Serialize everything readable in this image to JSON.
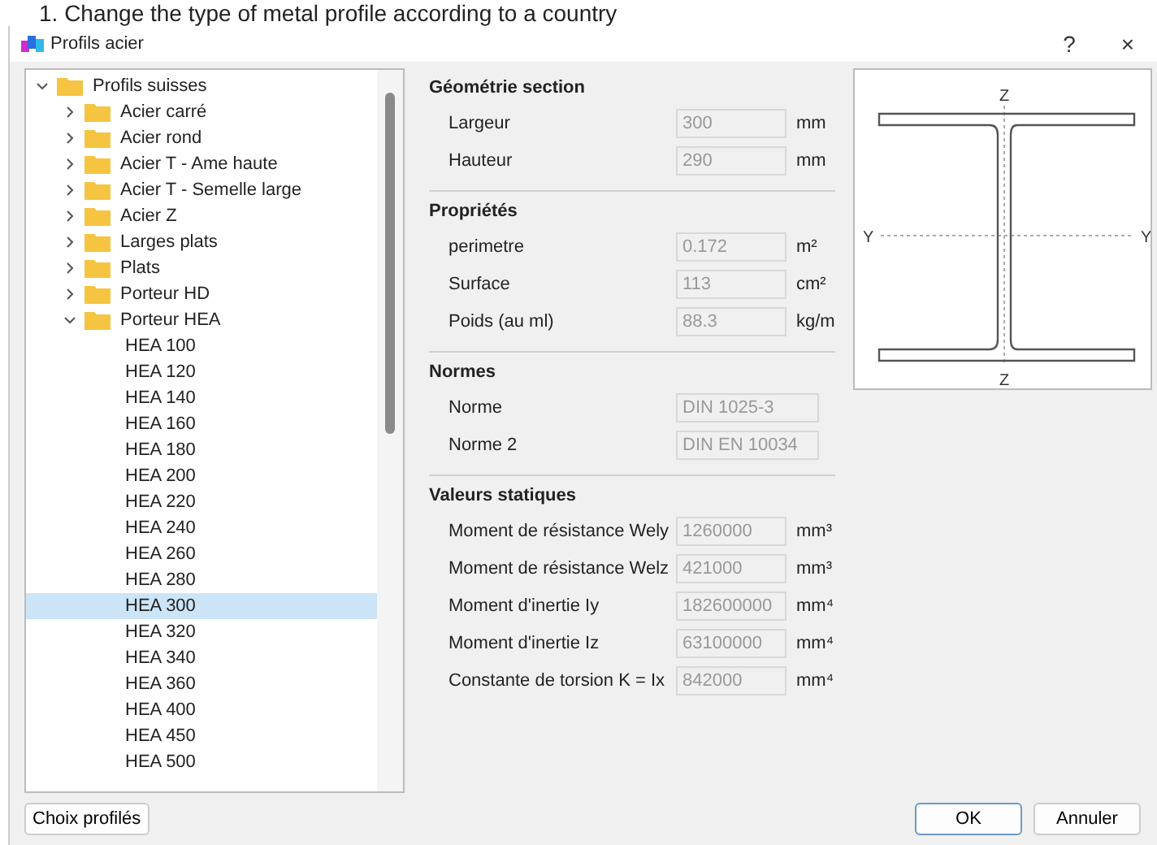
{
  "caption": "1. Change the type of metal profile according to a country",
  "window": {
    "title": "Profils acier",
    "help": "?",
    "close": "×"
  },
  "tree": [
    {
      "label": "Profils suisses",
      "kind": "folder",
      "expanded": true,
      "selected": false,
      "children": [
        {
          "label": "Acier carré",
          "kind": "folder",
          "expanded": false,
          "selected": false
        },
        {
          "label": "Acier rond",
          "kind": "folder",
          "expanded": false,
          "selected": false
        },
        {
          "label": "Acier T - Ame haute",
          "kind": "folder",
          "expanded": false,
          "selected": false
        },
        {
          "label": "Acier T - Semelle large",
          "kind": "folder",
          "expanded": false,
          "selected": false
        },
        {
          "label": "Acier Z",
          "kind": "folder",
          "expanded": false,
          "selected": false
        },
        {
          "label": "Larges plats",
          "kind": "folder",
          "expanded": false,
          "selected": false
        },
        {
          "label": "Plats",
          "kind": "folder",
          "expanded": false,
          "selected": false
        },
        {
          "label": "Porteur HD",
          "kind": "folder",
          "expanded": false,
          "selected": false
        },
        {
          "label": "Porteur HEA",
          "kind": "folder",
          "expanded": true,
          "selected": false,
          "children": [
            {
              "label": "HEA 100",
              "kind": "item",
              "selected": false
            },
            {
              "label": "HEA 120",
              "kind": "item",
              "selected": false
            },
            {
              "label": "HEA 140",
              "kind": "item",
              "selected": false
            },
            {
              "label": "HEA 160",
              "kind": "item",
              "selected": false
            },
            {
              "label": "HEA 180",
              "kind": "item",
              "selected": false
            },
            {
              "label": "HEA 200",
              "kind": "item",
              "selected": false
            },
            {
              "label": "HEA 220",
              "kind": "item",
              "selected": false
            },
            {
              "label": "HEA 240",
              "kind": "item",
              "selected": false
            },
            {
              "label": "HEA 260",
              "kind": "item",
              "selected": false
            },
            {
              "label": "HEA 280",
              "kind": "item",
              "selected": false
            },
            {
              "label": "HEA 300",
              "kind": "item",
              "selected": true
            },
            {
              "label": "HEA 320",
              "kind": "item",
              "selected": false
            },
            {
              "label": "HEA 340",
              "kind": "item",
              "selected": false
            },
            {
              "label": "HEA 360",
              "kind": "item",
              "selected": false
            },
            {
              "label": "HEA 400",
              "kind": "item",
              "selected": false
            },
            {
              "label": "HEA 450",
              "kind": "item",
              "selected": false
            },
            {
              "label": "HEA 500",
              "kind": "item",
              "selected": false
            }
          ]
        }
      ]
    }
  ],
  "sections": [
    {
      "title": "Géométrie section",
      "fields": [
        {
          "label": "Largeur",
          "value": "300",
          "unit": "mm"
        },
        {
          "label": "Hauteur",
          "value": "290",
          "unit": "mm"
        }
      ]
    },
    {
      "title": "Propriétés",
      "fields": [
        {
          "label": "perimetre",
          "value": "0.172",
          "unit": "m²"
        },
        {
          "label": "Surface",
          "value": "113",
          "unit": "cm²"
        },
        {
          "label": "Poids (au ml)",
          "value": "88.3",
          "unit": "kg/m"
        }
      ]
    },
    {
      "title": "Normes",
      "fields": [
        {
          "label": "Norme",
          "value": "DIN 1025-3"
        },
        {
          "label": "Norme 2",
          "value": "DIN EN 10034"
        }
      ]
    },
    {
      "title": "Valeurs statiques",
      "fields": [
        {
          "label": "Moment de résistance Wely",
          "value": "1260000",
          "unit": "mm³"
        },
        {
          "label": "Moment de résistance Welz",
          "value": "421000",
          "unit": "mm³"
        },
        {
          "label": "Moment d'inertie Iy",
          "value": "182600000",
          "unit": "mm⁴"
        },
        {
          "label": "Moment d'inertie Iz",
          "value": "63100000",
          "unit": "mm⁴"
        },
        {
          "label": "Constante de torsion K = Ix",
          "value": "842000",
          "unit": "mm⁴"
        }
      ]
    }
  ],
  "diagram": {
    "top": "Z",
    "bottom": "Z",
    "left": "Y",
    "right": "Y"
  },
  "buttons": {
    "left": "Choix profilés",
    "ok": "OK",
    "cancel": "Annuler"
  }
}
